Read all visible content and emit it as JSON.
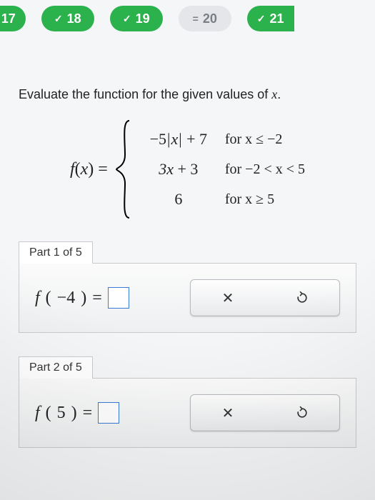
{
  "nav": [
    {
      "num": "17",
      "status": "done"
    },
    {
      "num": "18",
      "status": "done"
    },
    {
      "num": "19",
      "status": "done"
    },
    {
      "num": "20",
      "status": "current"
    },
    {
      "num": "21",
      "status": "done"
    }
  ],
  "prompt_a": "Evaluate the function for the given values of ",
  "prompt_var": "x",
  "prompt_b": ".",
  "func": {
    "f": "f",
    "x": "x",
    "eq": "="
  },
  "cases": [
    {
      "expr_pre": "−5",
      "abs": "x",
      "expr_post": " + 7",
      "cond": "for x ≤ −2"
    },
    {
      "expr": "3x + 3",
      "cond": "for −2 < x < 5"
    },
    {
      "expr": "6",
      "cond": "for x ≥ 5"
    }
  ],
  "parts": [
    {
      "label": "Part 1 of 5",
      "lhs_f": "f",
      "lhs_arg": "−4",
      "eq": "="
    },
    {
      "label": "Part 2 of 5",
      "lhs_f": "f",
      "lhs_arg": "5",
      "eq": "="
    }
  ],
  "icons": {
    "check": "✓",
    "current": "=",
    "clear": "✕"
  }
}
